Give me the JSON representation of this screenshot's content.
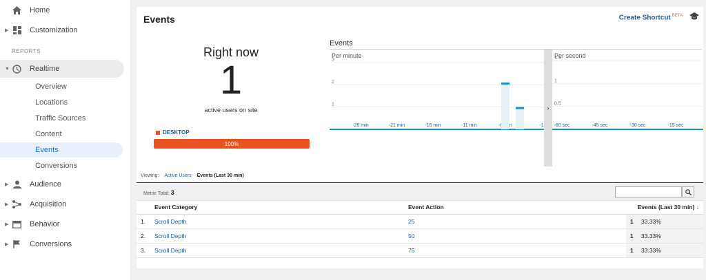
{
  "sidebar": {
    "home": "Home",
    "customization": "Customization",
    "reports_label": "REPORTS",
    "realtime": "Realtime",
    "realtime_items": [
      "Overview",
      "Locations",
      "Traffic Sources",
      "Content",
      "Events",
      "Conversions"
    ],
    "audience": "Audience",
    "acquisition": "Acquisition",
    "behavior": "Behavior",
    "conversions": "Conversions"
  },
  "page": {
    "title": "Events",
    "shortcut": "Create Shortcut",
    "shortcut_badge": "BETA"
  },
  "right_now": {
    "title": "Right now",
    "count": "1",
    "subtitle": "active users on site",
    "device_label": "DESKTOP",
    "device_percent": "100%",
    "device_share": 1.0,
    "device_color": "#e8531f"
  },
  "events_chart": {
    "title": "Events",
    "per_minute_label": "Per minute",
    "per_second_label": "Per second"
  },
  "chart_data": [
    {
      "type": "bar",
      "title": "Per minute",
      "x_ticks": [
        "-26 min",
        "-21 min",
        "-16 min",
        "-11 min",
        "-6 min",
        "-1"
      ],
      "y_ticks": [
        "1",
        "2",
        "3"
      ],
      "ylim": [
        0,
        3.7
      ],
      "bars": [
        {
          "minute": -6,
          "value": 2.1
        },
        {
          "minute": -4,
          "value": 1.0
        }
      ],
      "color": "#1c8ed3"
    },
    {
      "type": "bar",
      "title": "Per second",
      "x_ticks": [
        "-60 sec",
        "-45 sec",
        "-30 sec",
        "-15 sec"
      ],
      "y_ticks": [
        "0.5",
        "1",
        "1.5"
      ],
      "ylim": [
        0,
        1.8
      ],
      "bars": []
    }
  ],
  "viewing": {
    "label": "Viewing:",
    "active_users": "Active Users",
    "events": "Events (Last 30 min)"
  },
  "table": {
    "metric_total_label": "Metric Total:",
    "metric_total": "3",
    "headers": [
      "Event Category",
      "Event Action",
      "Events (Last 30 min)"
    ],
    "rows": [
      {
        "idx": "1.",
        "category": "Scroll Depth",
        "action": "25",
        "count": "1",
        "pct": "33.33%"
      },
      {
        "idx": "2.",
        "category": "Scroll Depth",
        "action": "50",
        "count": "1",
        "pct": "33.33%"
      },
      {
        "idx": "3.",
        "category": "Scroll Depth",
        "action": "75",
        "count": "1",
        "pct": "33.33%"
      }
    ]
  }
}
